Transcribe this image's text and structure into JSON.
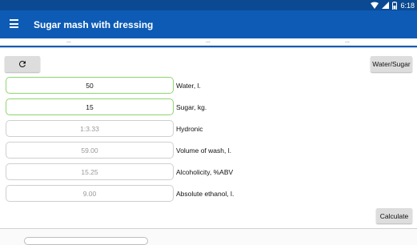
{
  "status_bar": {
    "time": "6:18",
    "icons": [
      "wifi-icon",
      "signal-icon",
      "battery-icon"
    ]
  },
  "app_bar": {
    "title": "Sugar mash with dressing",
    "menu_icon": "hamburger-menu-icon"
  },
  "tabs": [
    "...",
    "...",
    "..."
  ],
  "toolbar": {
    "refresh_icon": "refresh-icon",
    "ratio_label": "Water/Sugar"
  },
  "fields": [
    {
      "value": "50",
      "label": "Water, l.",
      "editable": true
    },
    {
      "value": "15",
      "label": "Sugar, kg.",
      "editable": true
    },
    {
      "value": "1:3.33",
      "label": "Hydronic",
      "editable": false
    },
    {
      "value": "59.00",
      "label": "Volume of wash, l.",
      "editable": false
    },
    {
      "value": "15.25",
      "label": "Alcoholicity, %ABV",
      "editable": false
    },
    {
      "value": "9.00",
      "label": "Absolute ethanol, l.",
      "editable": false
    }
  ],
  "actions": {
    "calculate_label": "Calculate"
  },
  "colors": {
    "app_bar": "#0d5bb5",
    "status_bar": "#0b4a92",
    "active_border": "#8fd470"
  }
}
